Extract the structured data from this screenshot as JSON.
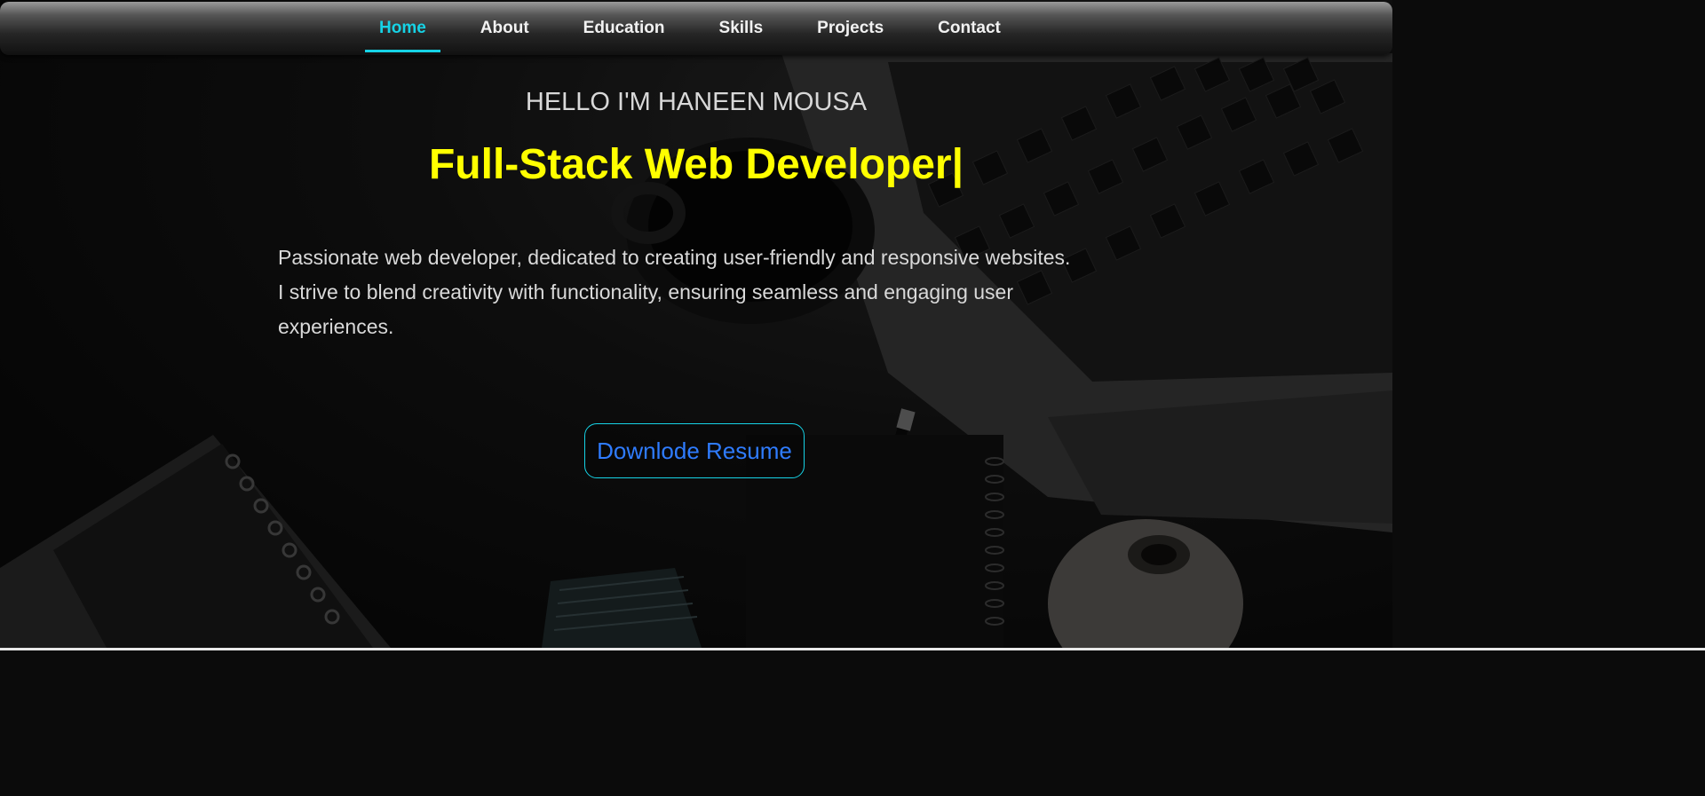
{
  "nav": {
    "items": [
      {
        "label": "Home",
        "active": true
      },
      {
        "label": "About",
        "active": false
      },
      {
        "label": "Education",
        "active": false
      },
      {
        "label": "Skills",
        "active": false
      },
      {
        "label": "Projects",
        "active": false
      },
      {
        "label": "Contact",
        "active": false
      }
    ]
  },
  "hero": {
    "greeting": "HELLO I'M HANEEN MOUSA",
    "role": "Full-Stack Web Developer|",
    "bio": "Passionate web developer, dedicated to creating user-friendly and responsive websites. I strive to blend creativity with functionality, ensuring seamless and engaging user experiences.",
    "resume_button": "Downlode Resume"
  },
  "colors": {
    "accent": "#16d3e6",
    "role_text": "#ffff00",
    "button_text": "#2f7cff"
  }
}
